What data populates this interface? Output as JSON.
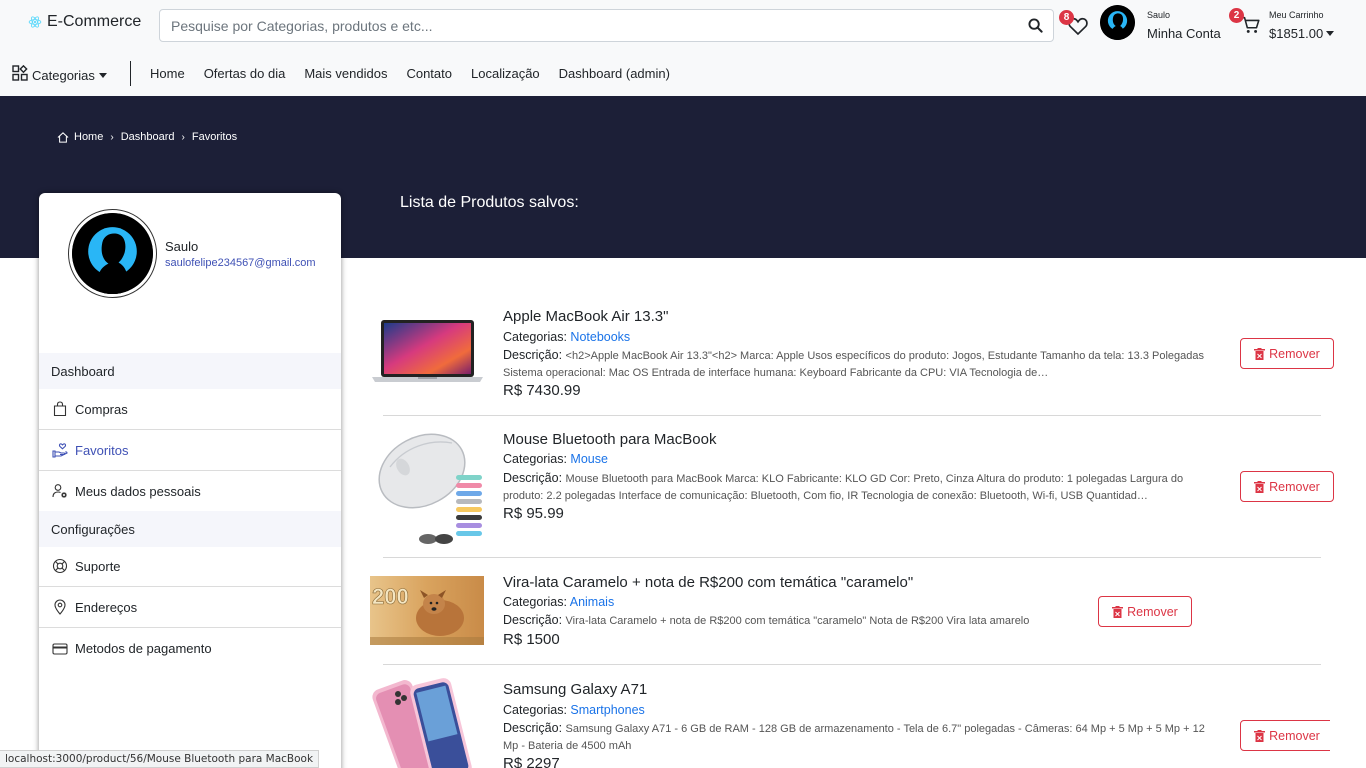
{
  "header": {
    "brand": "E-Commerce",
    "search_placeholder": "Pesquise por Categorias, produtos e etc...",
    "favorites_count": "8",
    "account_greeting": "Saulo",
    "account_label": "Minha Conta",
    "cart_count": "2",
    "cart_label": "Meu Carrinho",
    "cart_total": "$1851.00"
  },
  "nav": {
    "categories_label": "Categorias",
    "links": [
      "Home",
      "Ofertas do dia",
      "Mais vendidos",
      "Contato",
      "Localização",
      "Dashboard (admin)"
    ]
  },
  "breadcrumb": [
    "Home",
    "Dashboard",
    "Favoritos"
  ],
  "page": {
    "title": "Lista de Produtos salvos:"
  },
  "profile": {
    "name": "Saulo",
    "email": "saulofelipe234567@gmail.com"
  },
  "sidebar": {
    "section_dashboard": "Dashboard",
    "items_dashboard": [
      "Compras",
      "Favoritos",
      "Meus dados pessoais"
    ],
    "section_config": "Configurações",
    "items_config": [
      "Suporte",
      "Endereços",
      "Metodos de pagamento"
    ]
  },
  "labels": {
    "categories": "Categorias:",
    "description": "Descrição:",
    "remove": "Remover"
  },
  "products": [
    {
      "title": "Apple MacBook Air 13.3\"",
      "category": "Notebooks",
      "description": "<h2>Apple MacBook Air 13.3\"<h2> Marca: Apple Usos específicos do produto: Jogos, Estudante Tamanho da tela: 13.3 Polegadas Sistema operacional: Mac OS Entrada de interface humana: Keyboard Fabricante da CPU: VIA Tecnologia de…",
      "price": "R$ 7430.99"
    },
    {
      "title": "Mouse Bluetooth para MacBook",
      "category": "Mouse",
      "description": "Mouse Bluetooth para MacBook Marca: KLO Fabricante: KLO GD Cor: Preto, Cinza Altura do produto: 1 polegadas Largura do produto: 2.2 polegadas Interface de comunicação: Bluetooth, Com fio, IR Tecnologia de conexão: Bluetooth, Wi-fi, USB Quantidad…",
      "price": "R$ 95.99"
    },
    {
      "title": "Vira-lata Caramelo + nota de R$200 com temática \"caramelo\"",
      "category": "Animais",
      "description": "Vira-lata Caramelo + nota de R$200 com temática \"caramelo\" Nota de R$200 Vira lata amarelo",
      "price": "R$ 1500"
    },
    {
      "title": "Samsung Galaxy A71",
      "category": "Smartphones",
      "description": "Samsung Galaxy A71 - 6 GB de RAM - 128 GB de armazenamento - Tela de 6.7\" polegadas - Câmeras: 64 Mp + 5 Mp + 5 Mp + 12 Mp - Bateria de 4500 mAh",
      "price": "R$ 2297"
    }
  ],
  "image_text": {
    "banknote": "200"
  },
  "status_url": "localhost:3000/product/56/Mouse Bluetooth para MacBook",
  "colors": {
    "accent": "#3f51b5",
    "danger": "#dc3545",
    "banner": "#1c1f37",
    "link": "#1a73e8"
  }
}
